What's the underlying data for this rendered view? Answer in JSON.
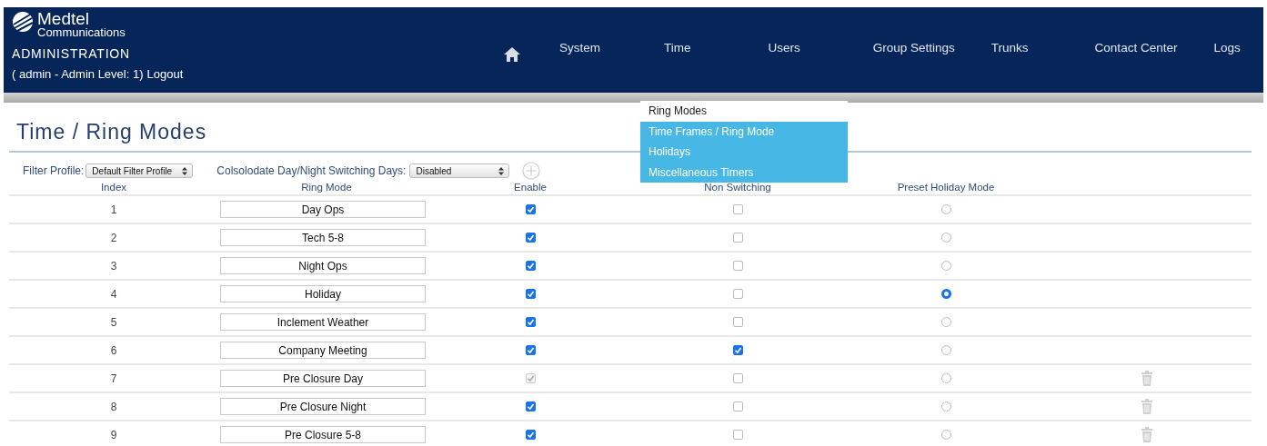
{
  "header": {
    "logo_name": "Medtel",
    "logo_sub": "Communications",
    "title": "ADMINISTRATION",
    "user_info": "( admin - Admin Level: 1)",
    "logout": "Logout"
  },
  "nav": [
    {
      "kind": "home"
    },
    {
      "kind": "text",
      "label": "System"
    },
    {
      "kind": "text",
      "label": "Time"
    },
    {
      "kind": "text",
      "label": "Users"
    },
    {
      "kind": "text",
      "label": "Group Settings"
    },
    {
      "kind": "text",
      "label": "Trunks"
    },
    {
      "kind": "text",
      "label": "Contact Center"
    },
    {
      "kind": "text",
      "label": "Logs"
    }
  ],
  "dropdown": [
    {
      "label": "Ring Modes",
      "selected": true
    },
    {
      "label": "Time Frames / Ring Mode",
      "selected": false
    },
    {
      "label": "Holidays",
      "selected": false
    },
    {
      "label": "Miscellaneous Timers",
      "selected": false
    }
  ],
  "page_title": "Time / Ring Modes",
  "filters": {
    "filter_label": "Filter Profile:",
    "filter_value": "Default Filter Profile",
    "consolidate_label": "Colsolodate Day/Night Switching Days:",
    "consolidate_value": "Disabled"
  },
  "table": {
    "columns": [
      "Index",
      "Ring Mode",
      "Enable",
      "Non Switching",
      "Preset Holiday Mode"
    ],
    "rows": [
      {
        "index": "1",
        "ring_mode": "Day Ops",
        "enable": true,
        "enable_disabled": false,
        "non_switching": false,
        "preset": false,
        "deletable": false
      },
      {
        "index": "2",
        "ring_mode": "Tech 5-8",
        "enable": true,
        "enable_disabled": false,
        "non_switching": false,
        "preset": false,
        "deletable": false
      },
      {
        "index": "3",
        "ring_mode": "Night Ops",
        "enable": true,
        "enable_disabled": false,
        "non_switching": false,
        "preset": false,
        "deletable": false
      },
      {
        "index": "4",
        "ring_mode": "Holiday",
        "enable": true,
        "enable_disabled": false,
        "non_switching": false,
        "preset": true,
        "deletable": false
      },
      {
        "index": "5",
        "ring_mode": "Inclement Weather",
        "enable": true,
        "enable_disabled": false,
        "non_switching": false,
        "preset": false,
        "deletable": false
      },
      {
        "index": "6",
        "ring_mode": "Company Meeting",
        "enable": true,
        "enable_disabled": false,
        "non_switching": true,
        "preset": false,
        "deletable": false
      },
      {
        "index": "7",
        "ring_mode": "Pre Closure Day",
        "enable": true,
        "enable_disabled": true,
        "non_switching": false,
        "preset": false,
        "deletable": true
      },
      {
        "index": "8",
        "ring_mode": "Pre Closure Night",
        "enable": true,
        "enable_disabled": false,
        "non_switching": false,
        "preset": false,
        "deletable": true
      },
      {
        "index": "9",
        "ring_mode": "Pre Closure 5-8",
        "enable": true,
        "enable_disabled": false,
        "non_switching": false,
        "preset": false,
        "deletable": true
      }
    ]
  }
}
